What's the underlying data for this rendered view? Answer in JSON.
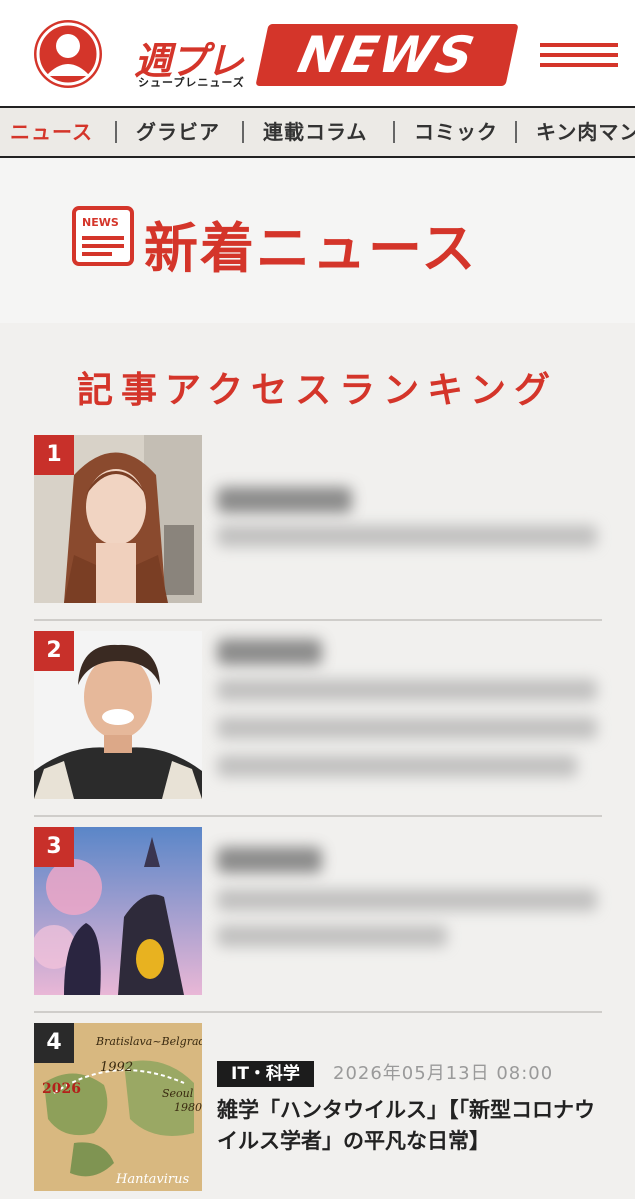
{
  "header": {
    "logo_kanji": "週プレ",
    "logo_kana": "シュープレニューズ",
    "logo_word": "NEWS",
    "colors": {
      "accent": "#d4352a",
      "nav_bg": "#eceae6",
      "section_bg": "#f1f0ee"
    },
    "icons": {
      "account": "user-icon",
      "menu": "hamburger-menu-icon"
    }
  },
  "nav": {
    "categories": [
      "ニュース",
      "グラビア",
      "連載コラム",
      "コミック",
      "キン肉マン"
    ]
  },
  "section": {
    "icon_tag": "NEWS",
    "title": "新着ニュース"
  },
  "ranking": {
    "title": "記事アクセスランキング",
    "items": [
      {
        "rank": "1"
      },
      {
        "rank": "2"
      },
      {
        "rank": "3"
      },
      {
        "rank": "4",
        "category": "IT・科学",
        "date": "2026年05月13日 08:00",
        "headline": "雑学「ハンタウイルス」【「新型コロナウイルス学者」の平凡な日常】",
        "thumb_text": {
          "cities": "Bratislava~Belgrade",
          "year1": "1992",
          "city2": "Seoul",
          "year2": "1980",
          "year3": "2026",
          "virus": "Hantavirus"
        }
      }
    ]
  }
}
